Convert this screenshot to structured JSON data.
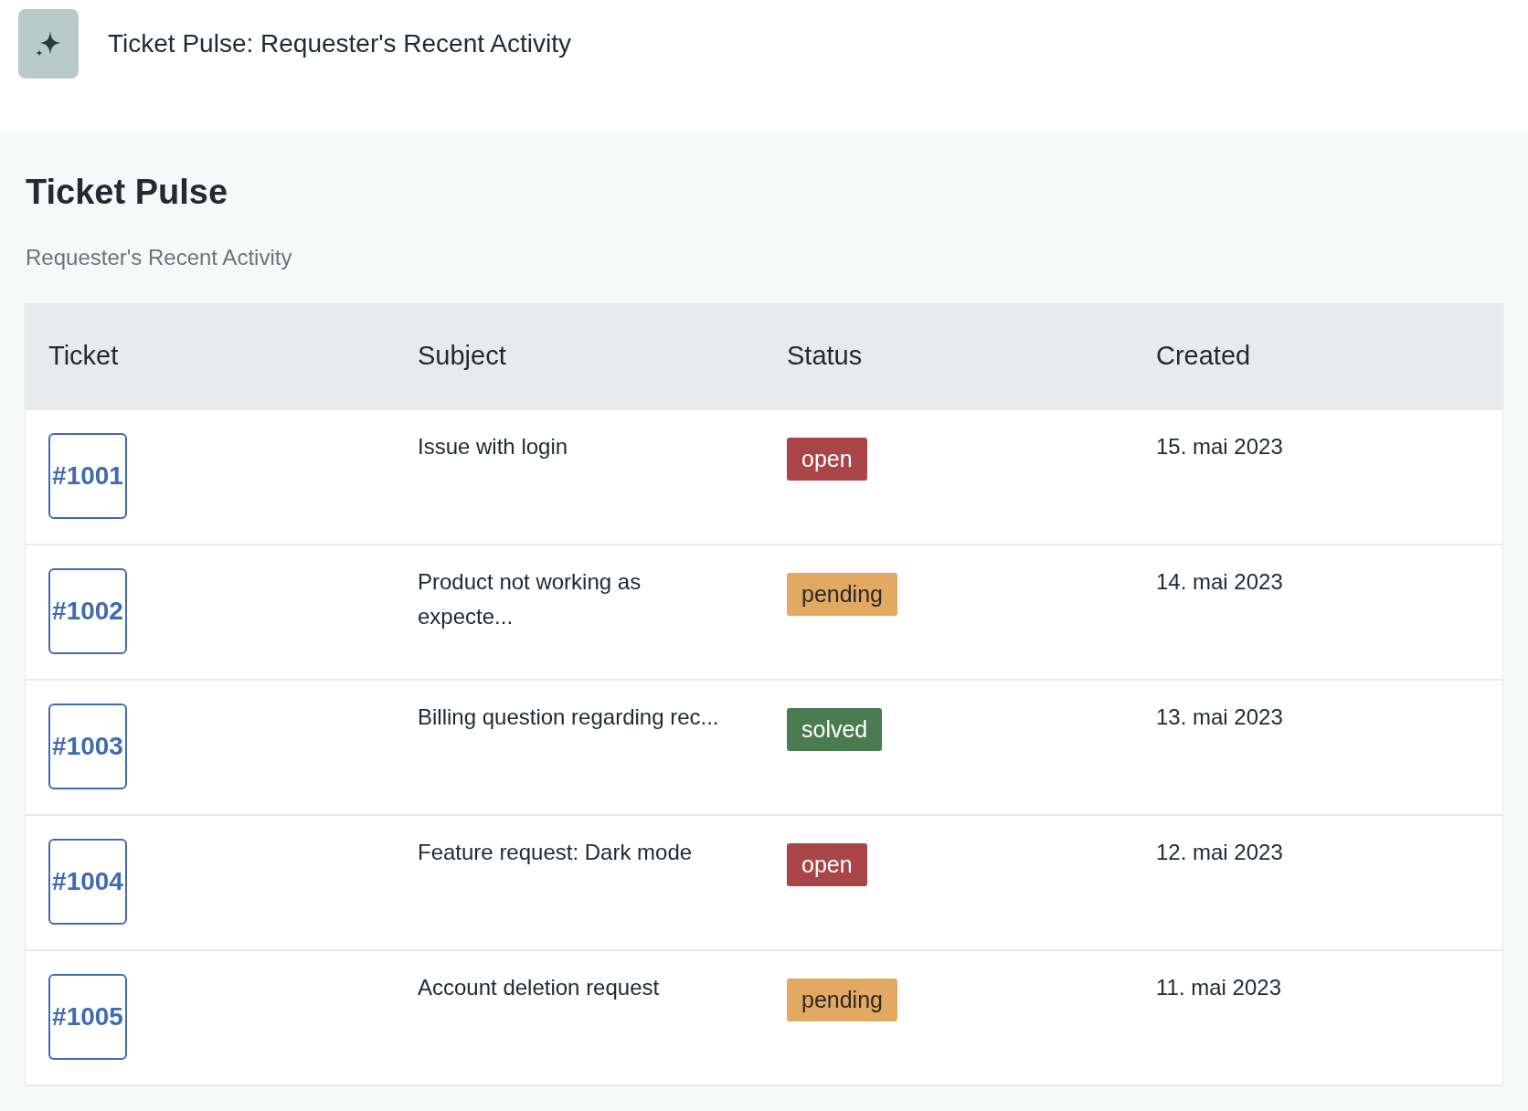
{
  "app_bar": {
    "title": "Ticket Pulse: Requester's Recent Activity"
  },
  "page": {
    "heading": "Ticket Pulse",
    "subtitle": "Requester's Recent Activity"
  },
  "table": {
    "columns": [
      "Ticket",
      "Subject",
      "Status",
      "Created"
    ],
    "rows": [
      {
        "ticket": "#1001",
        "subject": "Issue with login",
        "status": {
          "label": "open",
          "kind": "open"
        },
        "created": "15. mai 2023"
      },
      {
        "ticket": "#1002",
        "subject": "Product not working as expecte...",
        "status": {
          "label": "pending",
          "kind": "pending"
        },
        "created": "14. mai 2023"
      },
      {
        "ticket": "#1003",
        "subject": "Billing question regarding rec...",
        "status": {
          "label": "solved",
          "kind": "solved"
        },
        "created": "13. mai 2023"
      },
      {
        "ticket": "#1004",
        "subject": "Feature request: Dark mode",
        "status": {
          "label": "open",
          "kind": "open"
        },
        "created": "12. mai 2023"
      },
      {
        "ticket": "#1005",
        "subject": "Account deletion request",
        "status": {
          "label": "pending",
          "kind": "pending"
        },
        "created": "11. mai 2023"
      }
    ]
  }
}
